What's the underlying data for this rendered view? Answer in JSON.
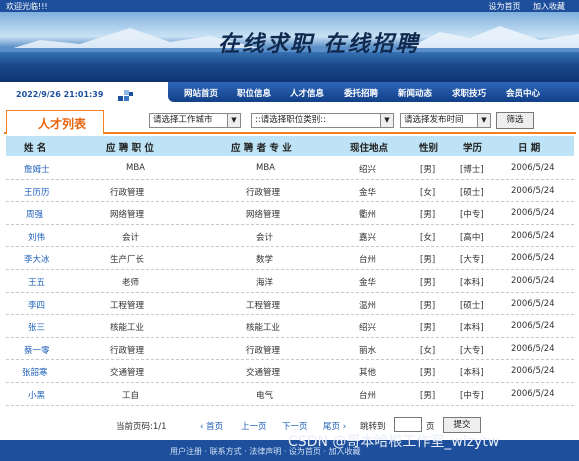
{
  "topbar": {
    "welcome": "欢迎光临!!!",
    "set_home": "设为首页",
    "add_fav": "加入收藏"
  },
  "banner": {
    "slogan": "在线求职  在线招聘"
  },
  "nav": {
    "date": "2022/9/26  21:01:39",
    "items": [
      "网站首页",
      "职位信息",
      "人才信息",
      "委托招聘",
      "新闻动态",
      "求职技巧",
      "会员中心"
    ]
  },
  "section": {
    "title": "人才列表"
  },
  "filters": {
    "city": "请选择工作城市",
    "category": "::请选择职位类别::",
    "time": "请选择发布时间",
    "button": "筛选"
  },
  "table": {
    "headers": [
      "姓  名",
      "应 聘 职 位",
      "应 聘 者 专 业",
      "现住地点",
      "性别",
      "学历",
      "日  期"
    ],
    "rows": [
      [
        "詹姆士",
        "MBA",
        "MBA",
        "绍兴",
        "[男]",
        "[博士]",
        "2006/5/24"
      ],
      [
        "王历历",
        "行政管理",
        "行政管理",
        "金华",
        "[女]",
        "[硕士]",
        "2006/5/24"
      ],
      [
        "周强",
        "网络管理",
        "网络管理",
        "衢州",
        "[男]",
        "[中专]",
        "2006/5/24"
      ],
      [
        "刘伟",
        "会计",
        "会计",
        "嘉兴",
        "[女]",
        "[高中]",
        "2006/5/24"
      ],
      [
        "李大冰",
        "生产厂长",
        "数学",
        "台州",
        "[男]",
        "[大专]",
        "2006/5/24"
      ],
      [
        "王五",
        "老师",
        "海洋",
        "金华",
        "[男]",
        "[本科]",
        "2006/5/24"
      ],
      [
        "李四",
        "工程管理",
        "工程管理",
        "温州",
        "[男]",
        "[硕士]",
        "2006/5/24"
      ],
      [
        "张三",
        "核能工业",
        "核能工业",
        "绍兴",
        "[男]",
        "[本科]",
        "2006/5/24"
      ],
      [
        "蔡一零",
        "行政管理",
        "行政管理",
        "丽水",
        "[女]",
        "[大专]",
        "2006/5/24"
      ],
      [
        "张韶寒",
        "交通管理",
        "交通管理",
        "其他",
        "[男]",
        "[本科]",
        "2006/5/24"
      ],
      [
        "小黑",
        "工自",
        "电气",
        "台州",
        "[男]",
        "[中专]",
        "2006/5/24"
      ]
    ]
  },
  "pager": {
    "current": "当前页码:1/1",
    "first": "首页",
    "prev": "上一页",
    "next": "下一页",
    "last": "尾页",
    "jump": "跳转到",
    "page": "页",
    "submit": "提交"
  },
  "footer": {
    "links": "用户注册 · 联系方式 · 法律声明 · 设为首页 · 加入收藏",
    "watermark": "CSDN @哥本哈根工作室_wlzytw"
  }
}
